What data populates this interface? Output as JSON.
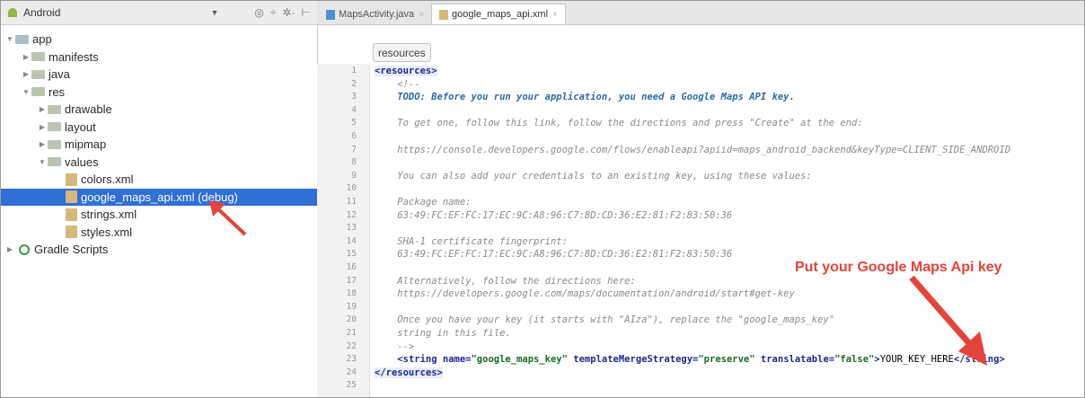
{
  "project_panel": {
    "view_selector": "Android",
    "tree": [
      {
        "label": "app",
        "depth": 0,
        "kind": "folder",
        "expanded": true
      },
      {
        "label": "manifests",
        "depth": 1,
        "kind": "folder",
        "expanded": false
      },
      {
        "label": "java",
        "depth": 1,
        "kind": "folder",
        "expanded": false
      },
      {
        "label": "res",
        "depth": 1,
        "kind": "folder",
        "expanded": true
      },
      {
        "label": "drawable",
        "depth": 2,
        "kind": "folder",
        "expanded": false
      },
      {
        "label": "layout",
        "depth": 2,
        "kind": "folder",
        "expanded": false
      },
      {
        "label": "mipmap",
        "depth": 2,
        "kind": "folder",
        "expanded": false
      },
      {
        "label": "values",
        "depth": 2,
        "kind": "folder",
        "expanded": true
      },
      {
        "label": "colors.xml",
        "depth": 3,
        "kind": "file"
      },
      {
        "label": "google_maps_api.xml (debug)",
        "depth": 3,
        "kind": "file",
        "selected": true
      },
      {
        "label": "strings.xml",
        "depth": 3,
        "kind": "file"
      },
      {
        "label": "styles.xml",
        "depth": 3,
        "kind": "file"
      },
      {
        "label": "Gradle Scripts",
        "depth": 0,
        "kind": "gradle"
      }
    ]
  },
  "editor": {
    "tabs": [
      {
        "label": "MapsActivity.java",
        "active": false
      },
      {
        "label": "google_maps_api.xml",
        "active": true
      }
    ],
    "breadcrumb": "resources",
    "lines": [
      {
        "n": "1",
        "parts": [
          {
            "t": "tag",
            "v": "<resources>"
          }
        ]
      },
      {
        "n": "2",
        "parts": [
          {
            "t": "cmt",
            "v": "    <!--"
          }
        ]
      },
      {
        "n": "3",
        "parts": [
          {
            "t": "todo",
            "v": "    TODO: Before you run your application, you need a Google Maps API key."
          }
        ]
      },
      {
        "n": "4",
        "parts": []
      },
      {
        "n": "5",
        "parts": [
          {
            "t": "cmt",
            "v": "    To get one, follow this link, follow the directions and press \"Create\" at the end:"
          }
        ]
      },
      {
        "n": "6",
        "parts": []
      },
      {
        "n": "7",
        "parts": [
          {
            "t": "cmt",
            "v": "    https://console.developers.google.com/flows/enableapi?apiid=maps_android_backend&keyType=CLIENT_SIDE_ANDROID"
          }
        ]
      },
      {
        "n": "8",
        "parts": []
      },
      {
        "n": "9",
        "parts": [
          {
            "t": "cmt",
            "v": "    You can also add your credentials to an existing key, using these values:"
          }
        ]
      },
      {
        "n": "10",
        "parts": []
      },
      {
        "n": "11",
        "parts": [
          {
            "t": "cmt",
            "v": "    Package name:"
          }
        ]
      },
      {
        "n": "12",
        "parts": [
          {
            "t": "cmt",
            "v": "    63:49:FC:EF:FC:17:EC:9C:A8:96:C7:8D:CD:36:E2:81:F2:83:50:36"
          }
        ]
      },
      {
        "n": "13",
        "parts": []
      },
      {
        "n": "14",
        "parts": [
          {
            "t": "cmt",
            "v": "    SHA-1 certificate fingerprint:"
          }
        ]
      },
      {
        "n": "15",
        "parts": [
          {
            "t": "cmt",
            "v": "    63:49:FC:EF:FC:17:EC:9C:A8:96:C7:8D:CD:36:E2:81:F2:83:50:36"
          }
        ]
      },
      {
        "n": "16",
        "parts": []
      },
      {
        "n": "17",
        "parts": [
          {
            "t": "cmt",
            "v": "    Alternatively, follow the directions here:"
          }
        ]
      },
      {
        "n": "18",
        "parts": [
          {
            "t": "cmt",
            "v": "    https://developers.google.com/maps/documentation/android/start#get-key"
          }
        ]
      },
      {
        "n": "19",
        "parts": []
      },
      {
        "n": "20",
        "parts": [
          {
            "t": "cmt",
            "v": "    Once you have your key (it starts with \"AIza\"), replace the \"google_maps_key\""
          }
        ]
      },
      {
        "n": "21",
        "parts": [
          {
            "t": "cmt",
            "v": "    string in this file."
          }
        ]
      },
      {
        "n": "22",
        "parts": [
          {
            "t": "cmt",
            "v": "    -->"
          }
        ]
      },
      {
        "n": "23",
        "parts": [
          {
            "t": "plain",
            "v": "    "
          },
          {
            "t": "attr",
            "v": "<string "
          },
          {
            "t": "attr",
            "v": "name="
          },
          {
            "t": "aval",
            "v": "\"google_maps_key\" "
          },
          {
            "t": "attr",
            "v": "templateMergeStrategy="
          },
          {
            "t": "aval",
            "v": "\"preserve\" "
          },
          {
            "t": "attr",
            "v": "translatable="
          },
          {
            "t": "aval",
            "v": "\"false\""
          },
          {
            "t": "attr",
            "v": ">"
          },
          {
            "t": "plain",
            "v": "YOUR_KEY_HERE"
          },
          {
            "t": "attr",
            "v": "</string>"
          }
        ]
      },
      {
        "n": "24",
        "parts": [
          {
            "t": "tag",
            "v": "</resources>"
          }
        ]
      },
      {
        "n": "25",
        "parts": []
      }
    ]
  },
  "annotation": {
    "text": "Put your Google Maps Api key",
    "color": "#e5433a"
  }
}
